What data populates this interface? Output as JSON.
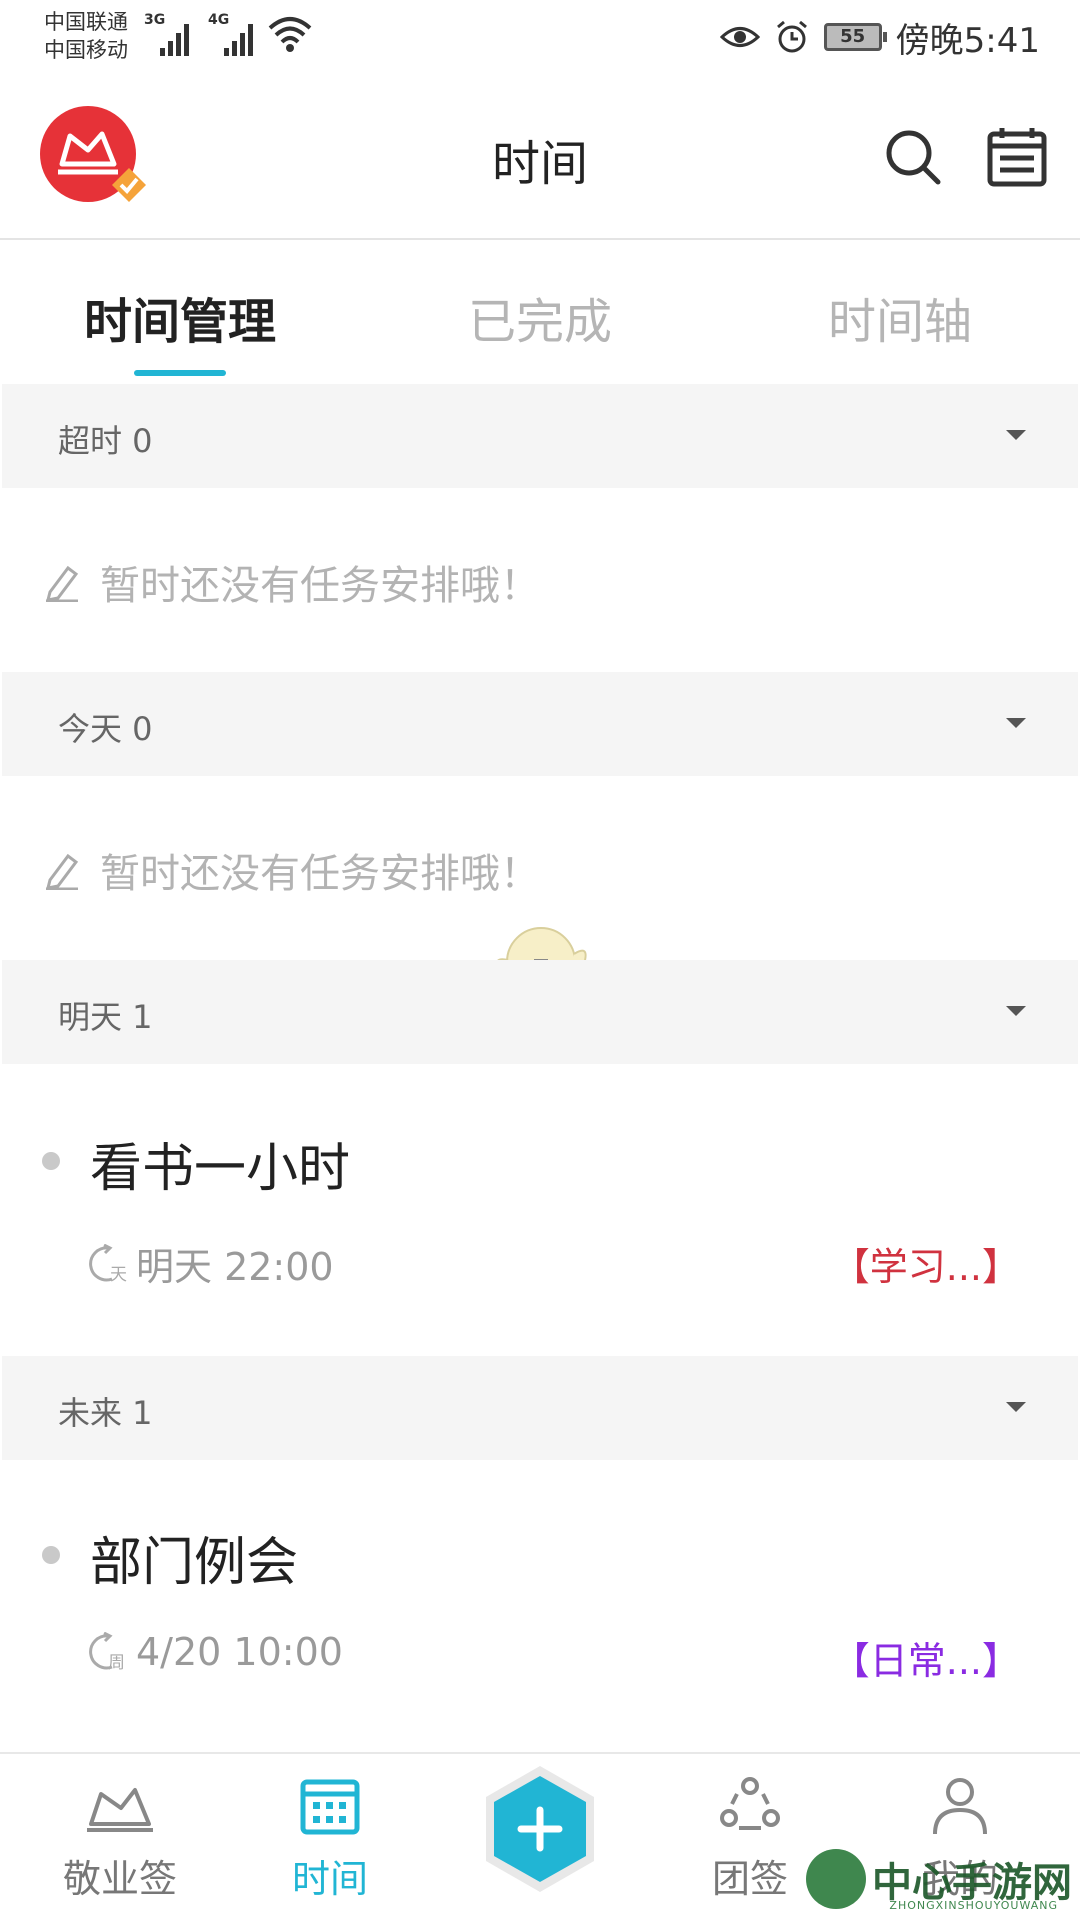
{
  "status_bar": {
    "carrier1": "中国联通",
    "carrier2": "中国移动",
    "network1": "3G",
    "network2": "4G",
    "battery": "55",
    "time": "傍晚5:41"
  },
  "header": {
    "title": "时间"
  },
  "tabs": [
    {
      "label": "时间管理",
      "active": true
    },
    {
      "label": "已完成",
      "active": false
    },
    {
      "label": "时间轴",
      "active": false
    }
  ],
  "sections": [
    {
      "title": "超时 0",
      "empty_text": "暂时还没有任务安排哦！"
    },
    {
      "title": "今天 0",
      "empty_text": "暂时还没有任务安排哦！"
    },
    {
      "title": "明天 1"
    },
    {
      "title": "未来 1"
    }
  ],
  "tasks": [
    {
      "title": "看书一小时",
      "repeat_glyph": "天",
      "time": "明天 22:00",
      "tag": "【学习...】",
      "tag_color": "#d0323f"
    },
    {
      "title": "部门例会",
      "repeat_glyph": "周",
      "time": "4/20 10:00",
      "tag": "【日常...】",
      "tag_color": "#8a2be2"
    }
  ],
  "bottom_nav": [
    {
      "label": "敬业签"
    },
    {
      "label": "时间",
      "active": true
    },
    {
      "label": "团签"
    },
    {
      "label": "我的"
    }
  ],
  "colors": {
    "accent": "#21b5d4",
    "logo": "#e63238",
    "badge": "#f5a33a"
  },
  "watermark": {
    "text": "中心手游网",
    "sub": "ZHONGXINSHOUYOUWANG"
  }
}
